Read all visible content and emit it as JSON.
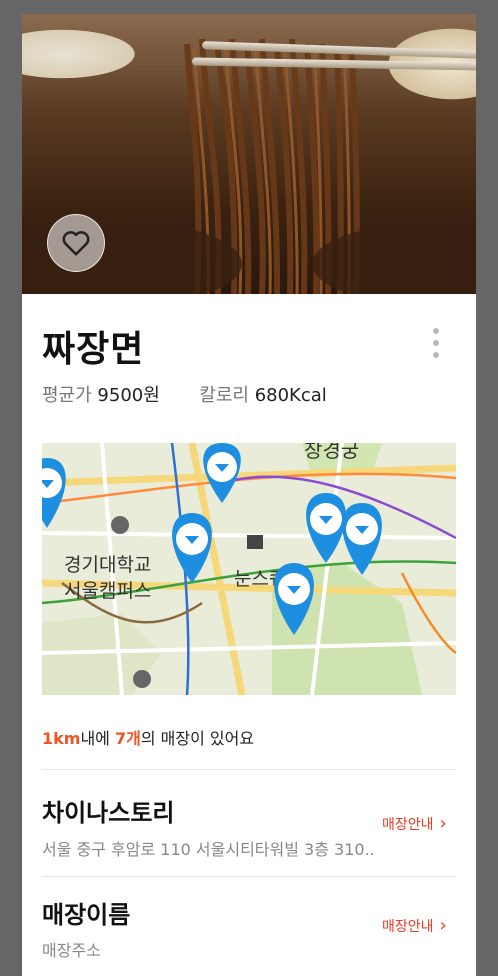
{
  "dish": {
    "name": "짜장면",
    "avg_price_label": "평균가",
    "avg_price_value": "9500원",
    "calorie_label": "칼로리",
    "calorie_value": "680Kcal"
  },
  "map": {
    "labels": [
      "창경궁",
      "경기대학교",
      "서울캠퍼스",
      "눈스퀘어"
    ],
    "pin_color": "#1e8fe0"
  },
  "stores_summary": {
    "distance": "1km",
    "prefix_suffix": "내에 ",
    "count": "7개",
    "tail": "의 매장이 있어요"
  },
  "stores": [
    {
      "name": "차이나스토리",
      "address": "서울 중구 후암로 110 서울시티타워빌 3층 310..",
      "link": "매장안내"
    },
    {
      "name": "매장이름",
      "address": "매장주소",
      "link": "매장안내"
    }
  ],
  "colors": {
    "accent": "#ee5522",
    "link": "#ee3a22",
    "background": "#666666"
  },
  "icons": {
    "favorite": "heart-icon",
    "more": "more-vertical-icon",
    "chevron": "chevron-right-icon"
  }
}
